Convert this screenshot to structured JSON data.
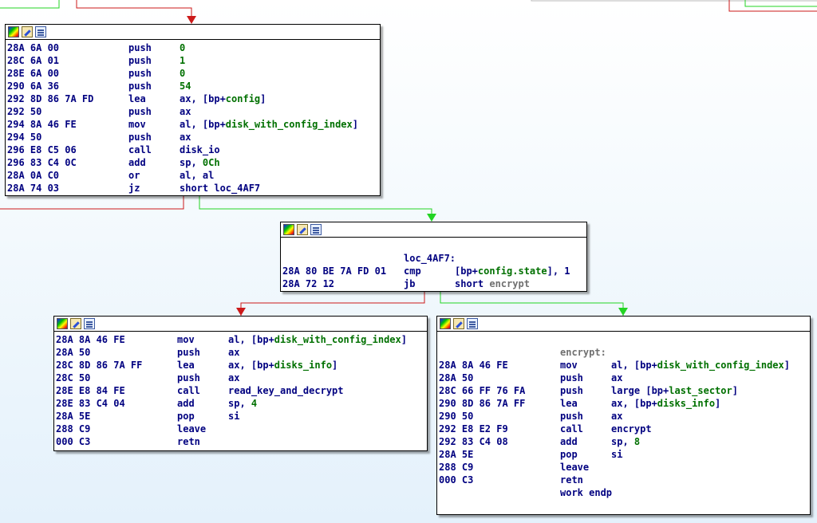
{
  "colors": {
    "true_edge": "#23d423",
    "false_edge": "#cc1a1a",
    "code": "#000080",
    "symbol": "#007000",
    "label_gray": "#707070"
  },
  "node1": {
    "rows": [
      {
        "addr": "28A 6A 00",
        "mn": "push",
        "opnd": [
          {
            "t": "0",
            "k": "num"
          }
        ]
      },
      {
        "addr": "28C 6A 01",
        "mn": "push",
        "opnd": [
          {
            "t": "1",
            "k": "num"
          }
        ]
      },
      {
        "addr": "28E 6A 00",
        "mn": "push",
        "opnd": [
          {
            "t": "0",
            "k": "num"
          }
        ]
      },
      {
        "addr": "290 6A 36",
        "mn": "push",
        "opnd": [
          {
            "t": "54",
            "k": "num"
          }
        ]
      },
      {
        "addr": "292 8D 86 7A FD",
        "mn": "lea",
        "opnd": [
          {
            "t": "ax, [bp+",
            "k": "ops"
          },
          {
            "t": "config",
            "k": "sym"
          },
          {
            "t": "]",
            "k": "ops"
          }
        ]
      },
      {
        "addr": "292 50",
        "mn": "push",
        "opnd": [
          {
            "t": "ax",
            "k": "ops"
          }
        ]
      },
      {
        "addr": "294 8A 46 FE",
        "mn": "mov",
        "opnd": [
          {
            "t": "al, [bp+",
            "k": "ops"
          },
          {
            "t": "disk_with_config_index",
            "k": "sym"
          },
          {
            "t": "]",
            "k": "ops"
          }
        ]
      },
      {
        "addr": "294 50",
        "mn": "push",
        "opnd": [
          {
            "t": "ax",
            "k": "ops"
          }
        ]
      },
      {
        "addr": "296 E8 C5 06",
        "mn": "call",
        "opnd": [
          {
            "t": "disk_io",
            "k": "ops"
          }
        ]
      },
      {
        "addr": "296 83 C4 0C",
        "mn": "add",
        "opnd": [
          {
            "t": "sp, ",
            "k": "ops"
          },
          {
            "t": "0Ch",
            "k": "num"
          }
        ]
      },
      {
        "addr": "28A 0A C0",
        "mn": "or",
        "opnd": [
          {
            "t": "al, al",
            "k": "ops"
          }
        ]
      },
      {
        "addr": "28A 74 03",
        "mn": "jz",
        "opnd": [
          {
            "t": "short loc_4AF7",
            "k": "ops"
          }
        ]
      }
    ]
  },
  "node2": {
    "label": "loc_4AF7:",
    "rows": [
      {
        "addr": "28A 80 BE 7A FD 01",
        "mn": "cmp",
        "opnd": [
          {
            "t": "[bp+",
            "k": "ops"
          },
          {
            "t": "config.state",
            "k": "sym"
          },
          {
            "t": "], 1",
            "k": "ops"
          }
        ]
      },
      {
        "addr": "28A 72 12",
        "mn": "jb",
        "opnd": [
          {
            "t": "short ",
            "k": "ops"
          },
          {
            "t": "encrypt",
            "k": "gray"
          }
        ]
      }
    ]
  },
  "node3": {
    "rows": [
      {
        "addr": "28A 8A 46 FE",
        "mn": "mov",
        "opnd": [
          {
            "t": "al, [bp+",
            "k": "ops"
          },
          {
            "t": "disk_with_config_index",
            "k": "sym"
          },
          {
            "t": "]",
            "k": "ops"
          }
        ]
      },
      {
        "addr": "28A 50",
        "mn": "push",
        "opnd": [
          {
            "t": "ax",
            "k": "ops"
          }
        ]
      },
      {
        "addr": "28C 8D 86 7A FF",
        "mn": "lea",
        "opnd": [
          {
            "t": "ax, [bp+",
            "k": "ops"
          },
          {
            "t": "disks_info",
            "k": "sym"
          },
          {
            "t": "]",
            "k": "ops"
          }
        ]
      },
      {
        "addr": "28C 50",
        "mn": "push",
        "opnd": [
          {
            "t": "ax",
            "k": "ops"
          }
        ]
      },
      {
        "addr": "28E E8 84 FE",
        "mn": "call",
        "opnd": [
          {
            "t": "read_key_and_decrypt",
            "k": "ops"
          }
        ]
      },
      {
        "addr": "28E 83 C4 04",
        "mn": "add",
        "opnd": [
          {
            "t": "sp, ",
            "k": "ops"
          },
          {
            "t": "4",
            "k": "num"
          }
        ]
      },
      {
        "addr": "28A 5E",
        "mn": "pop",
        "opnd": [
          {
            "t": "si",
            "k": "ops"
          }
        ]
      },
      {
        "addr": "288 C9",
        "mn": "leave",
        "opnd": []
      },
      {
        "addr": "000 C3",
        "mn": "retn",
        "opnd": []
      }
    ]
  },
  "node4": {
    "label": "encrypt:",
    "rows": [
      {
        "addr": "28A 8A 46 FE",
        "mn": "mov",
        "opnd": [
          {
            "t": "al, [bp+",
            "k": "ops"
          },
          {
            "t": "disk_with_config_index",
            "k": "sym"
          },
          {
            "t": "]",
            "k": "ops"
          }
        ]
      },
      {
        "addr": "28A 50",
        "mn": "push",
        "opnd": [
          {
            "t": "ax",
            "k": "ops"
          }
        ]
      },
      {
        "addr": "28C 66 FF 76 FA",
        "mn": "push",
        "opnd": [
          {
            "t": "large [bp+",
            "k": "ops"
          },
          {
            "t": "last_sector",
            "k": "sym"
          },
          {
            "t": "]",
            "k": "ops"
          }
        ]
      },
      {
        "addr": "290 8D 86 7A FF",
        "mn": "lea",
        "opnd": [
          {
            "t": "ax, [bp+",
            "k": "ops"
          },
          {
            "t": "disks_info",
            "k": "sym"
          },
          {
            "t": "]",
            "k": "ops"
          }
        ]
      },
      {
        "addr": "290 50",
        "mn": "push",
        "opnd": [
          {
            "t": "ax",
            "k": "ops"
          }
        ]
      },
      {
        "addr": "292 E8 E2 F9",
        "mn": "call",
        "opnd": [
          {
            "t": "encrypt",
            "k": "ops"
          }
        ]
      },
      {
        "addr": "292 83 C4 08",
        "mn": "add",
        "opnd": [
          {
            "t": "sp, ",
            "k": "ops"
          },
          {
            "t": "8",
            "k": "num"
          }
        ]
      },
      {
        "addr": "28A 5E",
        "mn": "pop",
        "opnd": [
          {
            "t": "si",
            "k": "ops"
          }
        ]
      },
      {
        "addr": "288 C9",
        "mn": "leave",
        "opnd": []
      },
      {
        "addr": "000 C3",
        "mn": "retn",
        "opnd": []
      },
      {
        "addr": "",
        "mn": "work endp",
        "opnd": []
      }
    ]
  }
}
